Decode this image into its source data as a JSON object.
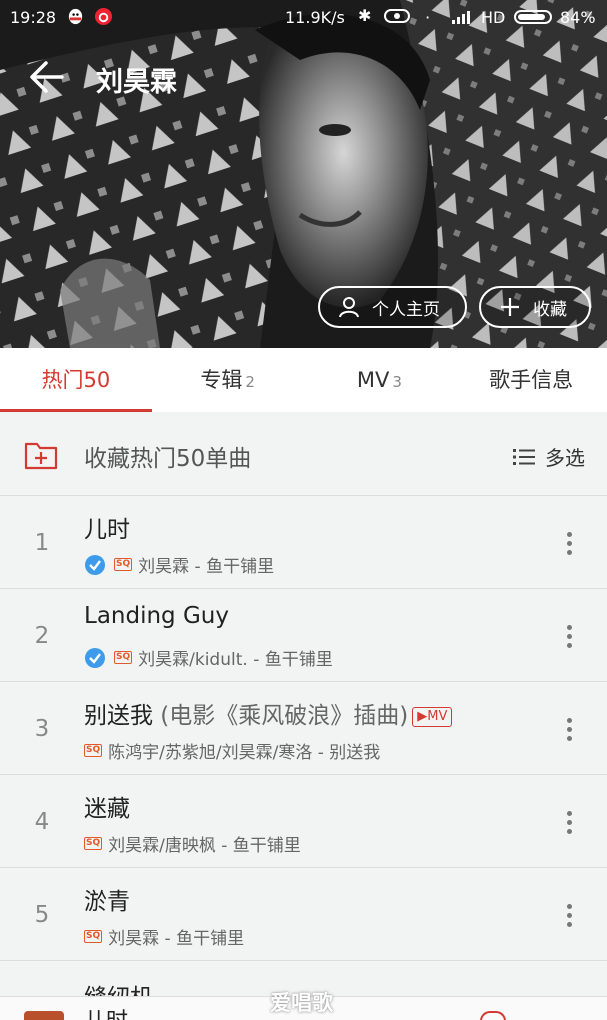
{
  "status_bar": {
    "time": "19:28",
    "network_speed": "11.9K/s",
    "network_type": "HD",
    "battery": "84%",
    "icons": [
      "qq-icon",
      "netease-icon",
      "bluetooth-icon",
      "eye-icon",
      "wifi-icon",
      "signal-icon",
      "battery-icon"
    ]
  },
  "header": {
    "title": "刘昊霖",
    "back_icon": "arrow-left-icon",
    "profile_button": "个人主页",
    "favorite_button": "收藏"
  },
  "tabs": [
    {
      "label": "热门50",
      "count": "",
      "active": true
    },
    {
      "label": "专辑",
      "count": "2",
      "active": false
    },
    {
      "label": "MV",
      "count": "3",
      "active": false
    },
    {
      "label": "歌手信息",
      "count": "",
      "active": false
    }
  ],
  "collect": {
    "label": "收藏热门50单曲",
    "multi_select": "多选"
  },
  "songs": [
    {
      "num": "1",
      "title": "儿时",
      "subtitle": "",
      "mv": "",
      "verified": true,
      "quality": "SQ",
      "meta": "刘昊霖 - 鱼干铺里"
    },
    {
      "num": "2",
      "title": "Landing Guy",
      "subtitle": "",
      "mv": "",
      "verified": true,
      "quality": "SQ",
      "meta": "刘昊霖/kidult. - 鱼干铺里"
    },
    {
      "num": "3",
      "title": "别送我",
      "subtitle": " (电影《乘风破浪》插曲)",
      "mv": "▶MV",
      "verified": false,
      "quality": "SQ",
      "meta": "陈鸿宇/苏紫旭/刘昊霖/寒洛 - 别送我"
    },
    {
      "num": "4",
      "title": "迷藏",
      "subtitle": "",
      "mv": "",
      "verified": false,
      "quality": "SQ",
      "meta": "刘昊霖/唐映枫 - 鱼干铺里"
    },
    {
      "num": "5",
      "title": "淤青",
      "subtitle": "",
      "mv": "",
      "verified": false,
      "quality": "SQ",
      "meta": "刘昊霖 - 鱼干铺里"
    }
  ],
  "partial_song": "缝纫机",
  "player": {
    "title": "儿时"
  },
  "watermark": "爱唱歌",
  "colors": {
    "accent": "#d33a31",
    "sq_badge": "#e25a2b",
    "verified": "#3d9be9"
  }
}
